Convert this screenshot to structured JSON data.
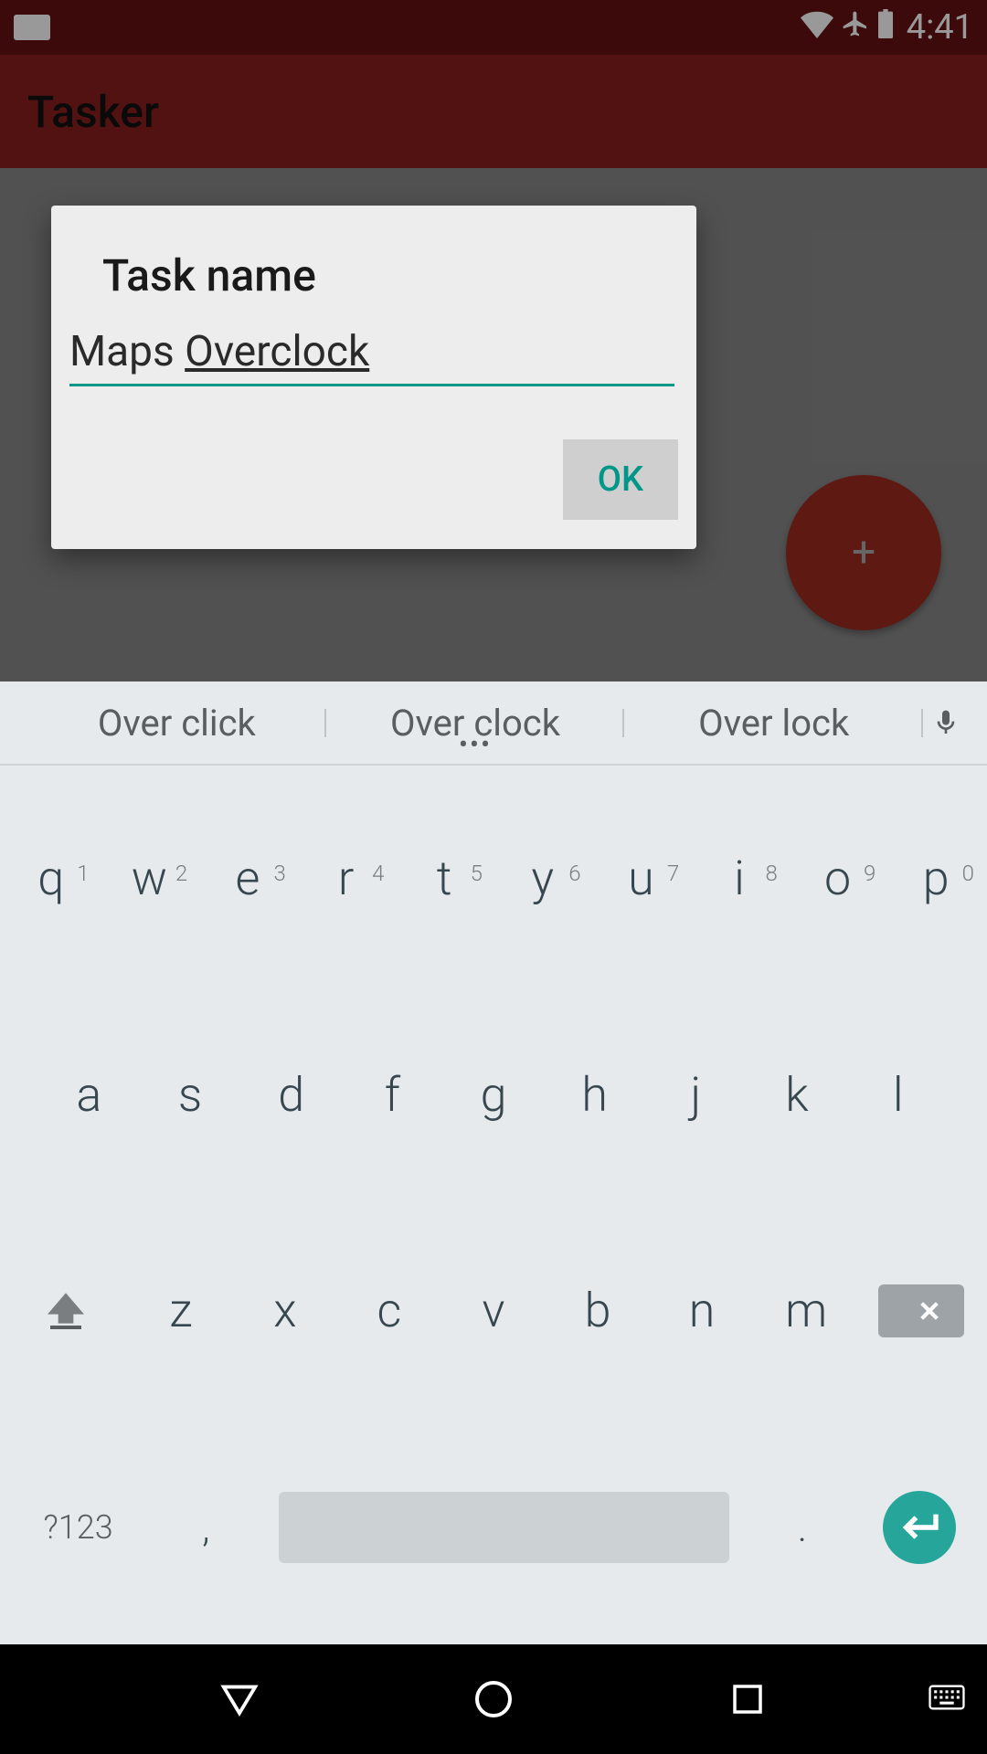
{
  "status": {
    "time": "4:41"
  },
  "app": {
    "title": "Tasker"
  },
  "fab": {
    "icon_label": "+"
  },
  "dialog": {
    "title": "Task name",
    "input_prefix": "Maps ",
    "input_underlined": "Overclock",
    "ok_label": "OK"
  },
  "keyboard": {
    "suggestions": [
      "Over click",
      "Over clock",
      "Over lock"
    ],
    "row1": [
      {
        "letter": "q",
        "hint": "1"
      },
      {
        "letter": "w",
        "hint": "2"
      },
      {
        "letter": "e",
        "hint": "3"
      },
      {
        "letter": "r",
        "hint": "4"
      },
      {
        "letter": "t",
        "hint": "5"
      },
      {
        "letter": "y",
        "hint": "6"
      },
      {
        "letter": "u",
        "hint": "7"
      },
      {
        "letter": "i",
        "hint": "8"
      },
      {
        "letter": "o",
        "hint": "9"
      },
      {
        "letter": "p",
        "hint": "0"
      }
    ],
    "row2": [
      {
        "letter": "a"
      },
      {
        "letter": "s"
      },
      {
        "letter": "d"
      },
      {
        "letter": "f"
      },
      {
        "letter": "g"
      },
      {
        "letter": "h"
      },
      {
        "letter": "j"
      },
      {
        "letter": "k"
      },
      {
        "letter": "l"
      }
    ],
    "row3": [
      {
        "letter": "z"
      },
      {
        "letter": "x"
      },
      {
        "letter": "c"
      },
      {
        "letter": "v"
      },
      {
        "letter": "b"
      },
      {
        "letter": "n"
      },
      {
        "letter": "m"
      }
    ],
    "sym_label": "?123",
    "comma": ",",
    "period": "."
  }
}
